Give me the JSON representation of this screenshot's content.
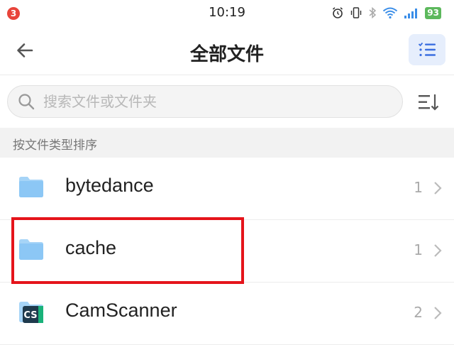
{
  "status_bar": {
    "notification_count": "3",
    "time": "10:19",
    "battery": "93"
  },
  "header": {
    "title": "全部文件"
  },
  "search": {
    "placeholder": "搜索文件或文件夹"
  },
  "section": {
    "label": "按文件类型排序"
  },
  "files": [
    {
      "name": "bytedance",
      "count": "1",
      "icon": "folder-icon"
    },
    {
      "name": "cache",
      "count": "1",
      "icon": "folder-icon"
    },
    {
      "name": "CamScanner",
      "count": "2",
      "icon": "camscanner-app-icon",
      "icon_text": "CS"
    }
  ],
  "colors": {
    "accent": "#3b6fe0",
    "folder": "#8cc7f5",
    "highlight": "#e5141b",
    "battery": "#5cb85c",
    "badge": "#e8443a"
  }
}
